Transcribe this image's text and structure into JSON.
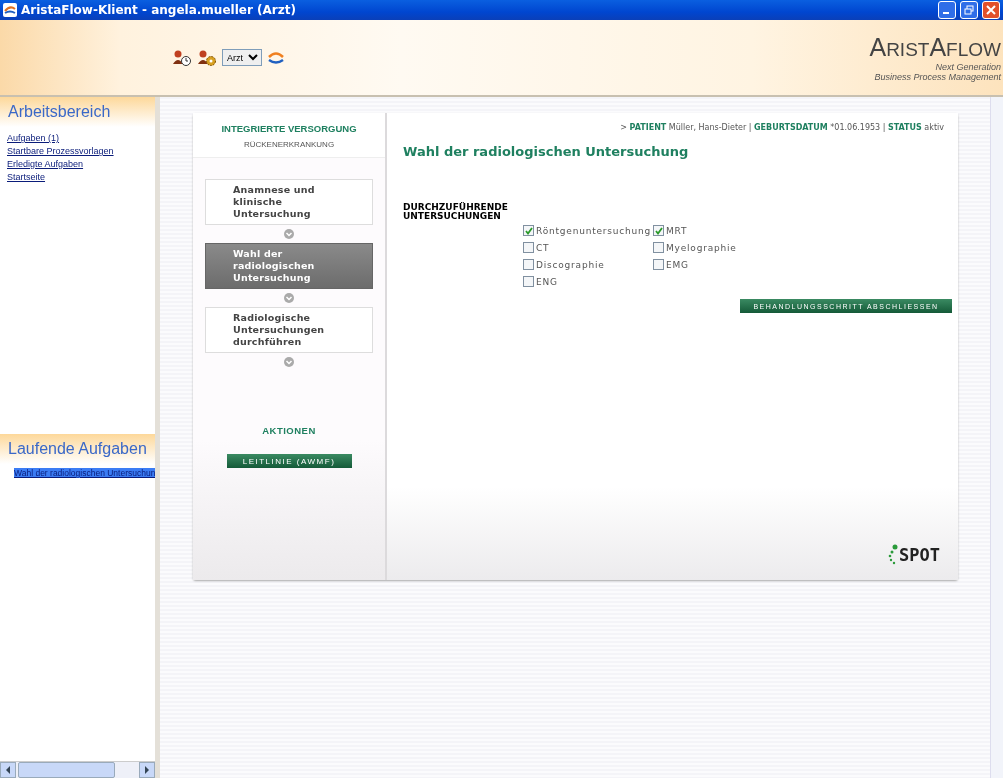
{
  "window": {
    "title": "AristaFlow-Klient - angela.mueller (Arzt)"
  },
  "toolbar": {
    "role_select": {
      "value": "Arzt"
    }
  },
  "logo": {
    "name": "ARISTAFLOW",
    "tagline_1": "Next Generation",
    "tagline_2": "Business Process Management"
  },
  "workspace": {
    "title": "Arbeitsbereich",
    "links": [
      "Aufgaben (1)",
      "Startbare Prozessvorlagen",
      "Erledigte Aufgaben",
      "Startseite"
    ]
  },
  "running_tasks": {
    "title": "Laufende Aufgaben",
    "items": [
      {
        "label": "Wahl der radiologischen Untersuchun",
        "selected": true
      }
    ]
  },
  "process": {
    "title": "INTEGRIERTE VERSORGUNG",
    "subtitle": "RÜCKENERKRANKUNG",
    "steps": [
      {
        "label": "Anamnese und klinische Untersuchung",
        "selected": false
      },
      {
        "label": "Wahl der radiologischen Untersuchung",
        "selected": true
      },
      {
        "label": "Radiologische Untersuchungen durchführen",
        "selected": false
      }
    ],
    "actions_title": "AKTIONEN",
    "actions": [
      "LEITLINIE (AWMF)"
    ]
  },
  "form": {
    "patient_line": "> **PATIENT** Müller, Hans-Dieter | **GEBURTSDATUM** *01.06.1953 | **STATUS** aktiv",
    "title": "Wahl der radiologischen Untersuchung",
    "field_label": "DURCHZUFÜHRENDE UNTERSUCHUNGEN",
    "options": [
      {
        "label": "Röntgenuntersuchung",
        "checked": true
      },
      {
        "label": "MRT",
        "checked": true
      },
      {
        "label": "CT",
        "checked": false
      },
      {
        "label": "Myelographie",
        "checked": false
      },
      {
        "label": "Discographie",
        "checked": false
      },
      {
        "label": "EMG",
        "checked": false
      },
      {
        "label": "ENG",
        "checked": false
      }
    ],
    "submit": "BEHANDLUNGSSCHRITT ABSCHLIESSEN",
    "brand": "SPOT"
  }
}
